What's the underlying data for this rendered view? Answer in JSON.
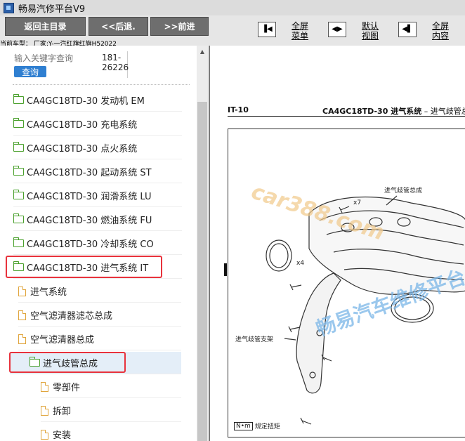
{
  "app": {
    "title": "畅易汽修平台V9"
  },
  "toolbar": {
    "back_main": "返回主目录",
    "back": "<<后退.",
    "forward": ">>前进",
    "fullscreen_menu": [
      "全屏",
      "菜单"
    ],
    "default_view": [
      "默认",
      "视图"
    ],
    "fullscreen_content": [
      "全屏",
      "内容"
    ]
  },
  "car_type": "当前车型： 厂家:Y-一汽红旗红旗H52022",
  "search": {
    "placeholder": "输入关键字查询",
    "button": "查询",
    "code_line1": "181-",
    "code_line2": "26226"
  },
  "tree": [
    {
      "label": "CA4GC18TD-30 发动机 EM",
      "kind": "folder"
    },
    {
      "label": "CA4GC18TD-30 充电系统",
      "kind": "folder"
    },
    {
      "label": "CA4GC18TD-30 点火系统",
      "kind": "folder"
    },
    {
      "label": "CA4GC18TD-30 起动系统 ST",
      "kind": "folder"
    },
    {
      "label": "CA4GC18TD-30 润滑系统 LU",
      "kind": "folder"
    },
    {
      "label": "CA4GC18TD-30 燃油系统 FU",
      "kind": "folder"
    },
    {
      "label": "CA4GC18TD-30 冷却系统 CO",
      "kind": "folder"
    },
    {
      "label": "CA4GC18TD-30 进气系统 IT",
      "kind": "folder-open",
      "highlighted": true
    },
    {
      "label": "进气系统",
      "kind": "doc"
    },
    {
      "label": "空气滤清器滤芯总成",
      "kind": "doc"
    },
    {
      "label": "空气滤清器总成",
      "kind": "doc"
    },
    {
      "label": "进气歧管总成",
      "kind": "folder-open",
      "highlighted": true,
      "selected": true
    },
    {
      "label": "零部件",
      "kind": "doc"
    },
    {
      "label": "拆卸",
      "kind": "doc"
    },
    {
      "label": "安装",
      "kind": "doc"
    }
  ],
  "document": {
    "code": "IT-10",
    "title_bold": "CA4GC18TD-30 进气系统",
    "title_rest": " – 进气歧管总成",
    "labels": {
      "manifold": "进气歧管总成",
      "bracket": "进气歧管支架",
      "qty_x7": "x7",
      "qty_x4": "x4"
    },
    "torque_unit": "N•m",
    "torque_text": "规定扭矩"
  },
  "watermarks": {
    "site": "car388.com",
    "brand": "畅易汽车维修平台"
  },
  "colors": {
    "highlight": "#e8323c",
    "search_button": "#2f7fd1",
    "folder": "#4aa02c",
    "doc": "#e0a53c"
  }
}
